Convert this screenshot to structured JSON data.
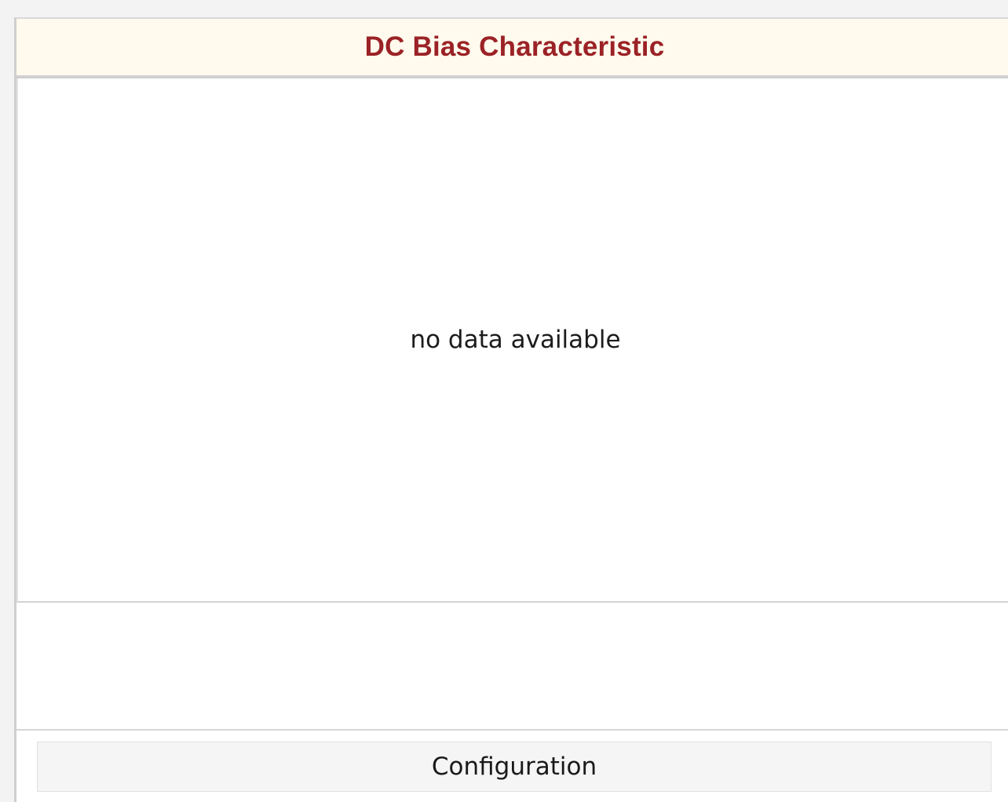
{
  "panel": {
    "title": "DC Bias Characteristic",
    "title_color": "#9b2226",
    "header_background": "#fffaed"
  },
  "chart": {
    "empty_message": "no data available"
  },
  "actions": {
    "configuration_label": "Configuration"
  }
}
